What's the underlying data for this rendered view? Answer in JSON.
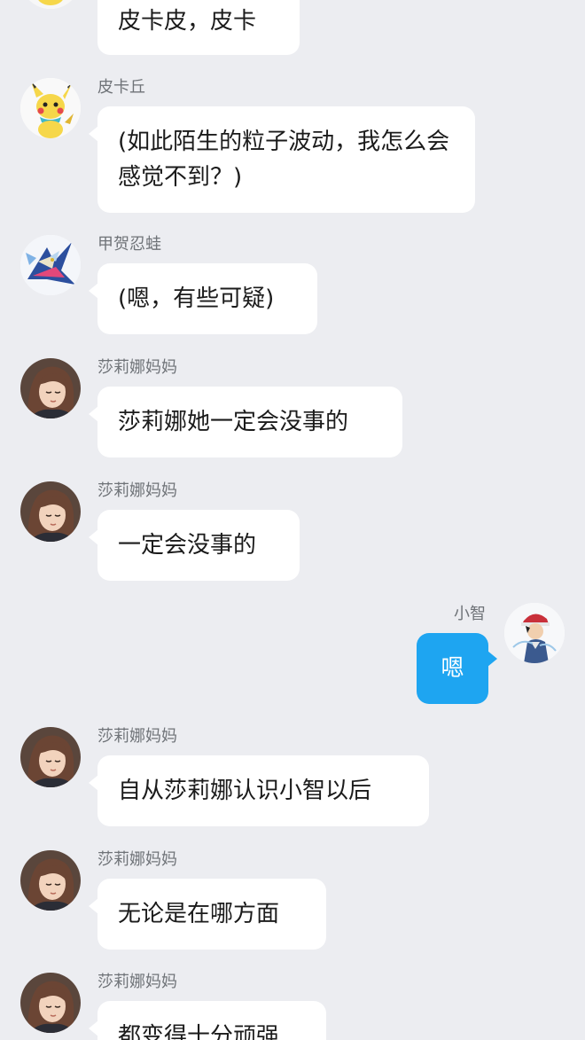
{
  "colors": {
    "background": "#ecedf1",
    "bubble_other": "#ffffff",
    "bubble_self": "#1ea5f1",
    "sender_name": "#6f7378"
  },
  "messages": [
    {
      "sender": "",
      "text": "皮卡皮，皮卡",
      "avatar": "pikachu-avatar",
      "side": "left"
    },
    {
      "sender": "皮卡丘",
      "text": "(如此陌生的粒子波动，我怎么会感觉不到？)",
      "avatar": "pikachu-avatar",
      "side": "left"
    },
    {
      "sender": "甲贺忍蛙",
      "text": "(嗯，有些可疑)",
      "avatar": "greninja-avatar",
      "side": "left"
    },
    {
      "sender": "莎莉娜妈妈",
      "text": "莎莉娜她一定会没事的",
      "avatar": "serena-mom-avatar",
      "side": "left"
    },
    {
      "sender": "莎莉娜妈妈",
      "text": "一定会没事的",
      "avatar": "serena-mom-avatar",
      "side": "left"
    },
    {
      "sender": "小智",
      "text": "嗯",
      "avatar": "ash-avatar",
      "side": "right"
    },
    {
      "sender": "莎莉娜妈妈",
      "text": "自从莎莉娜认识小智以后",
      "avatar": "serena-mom-avatar",
      "side": "left"
    },
    {
      "sender": "莎莉娜妈妈",
      "text": "无论是在哪方面",
      "avatar": "serena-mom-avatar",
      "side": "left"
    },
    {
      "sender": "莎莉娜妈妈",
      "text": "都变得十分顽强",
      "avatar": "serena-mom-avatar",
      "side": "left"
    }
  ]
}
